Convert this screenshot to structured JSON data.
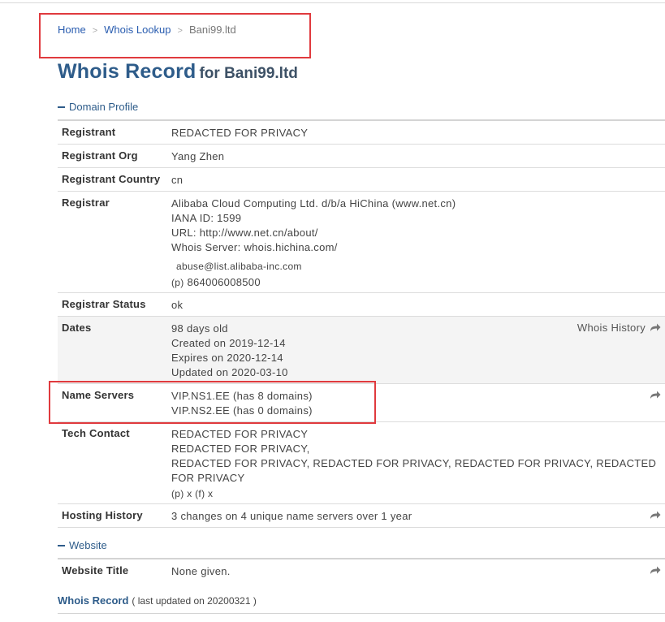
{
  "breadcrumb": {
    "home": "Home",
    "whois_lookup": "Whois Lookup",
    "current": "Bani99.ltd",
    "separator": ">"
  },
  "title": {
    "main": "Whois Record",
    "for": "for Bani99.ltd"
  },
  "sections": {
    "domain_profile": "Domain Profile",
    "website": "Website"
  },
  "rows": {
    "registrant": {
      "label": "Registrant",
      "value": "REDACTED FOR PRIVACY"
    },
    "registrant_org": {
      "label": "Registrant Org",
      "value": "Yang Zhen"
    },
    "registrant_country": {
      "label": "Registrant Country",
      "value": "cn"
    },
    "registrar": {
      "label": "Registrar",
      "name": "Alibaba Cloud Computing Ltd. d/b/a HiChina (www.net.cn)",
      "iana": "IANA ID: 1599",
      "url": "URL: http://www.net.cn/about/",
      "whois_server": "Whois Server: whois.hichina.com/",
      "email": "abuse@list.alibaba-inc.com",
      "phone_prefix": "(p)",
      "phone": "864006008500"
    },
    "registrar_status": {
      "label": "Registrar Status",
      "value": "ok"
    },
    "dates": {
      "label": "Dates",
      "age": "98 days old",
      "created": "Created on 2019-12-14",
      "expires": "Expires on 2020-12-14",
      "updated": "Updated on 2020-03-10",
      "history_link": "Whois History"
    },
    "name_servers": {
      "label": "Name Servers",
      "ns1": "VIP.NS1.EE (has 8 domains)",
      "ns2": "VIP.NS2.EE (has 0 domains)"
    },
    "tech_contact": {
      "label": "Tech Contact",
      "line1": "REDACTED FOR PRIVACY",
      "line2": "REDACTED FOR PRIVACY,",
      "line3": "REDACTED FOR PRIVACY, REDACTED FOR PRIVACY, REDACTED FOR PRIVACY, REDACTED FOR PRIVACY",
      "line4": "(p)  x  (f)  x"
    },
    "hosting_history": {
      "label": "Hosting History",
      "value": "3 changes on 4 unique name servers over 1 year"
    },
    "website_title": {
      "label": "Website Title",
      "value": "None given."
    }
  },
  "footer": {
    "title": "Whois Record",
    "updated": "( last updated on 20200321 )"
  },
  "colors": {
    "accent": "#2e5c8a",
    "highlight": "#e03a3e",
    "link": "#2a5db0"
  },
  "icons": {
    "share": "share-arrow-icon"
  }
}
